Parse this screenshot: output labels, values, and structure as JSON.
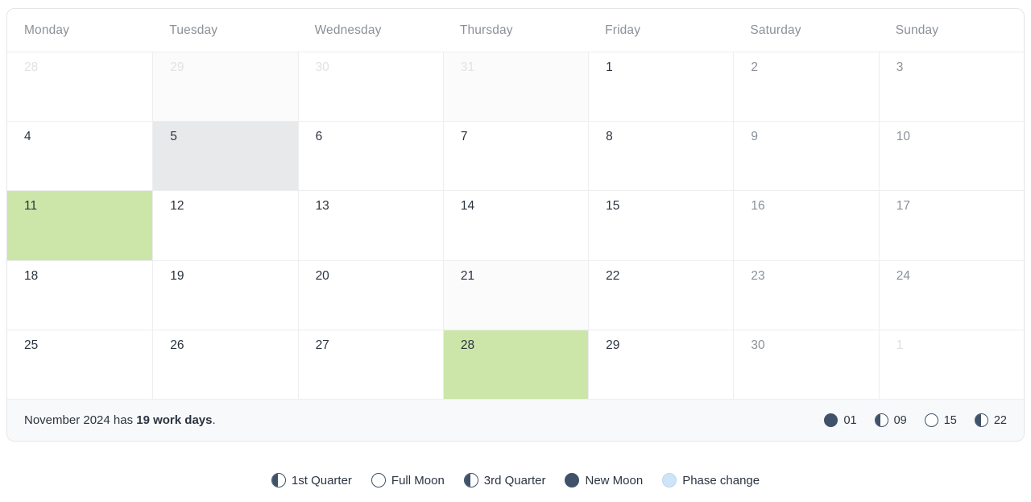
{
  "calendar": {
    "month_label": "November 2024",
    "weekday_headers": [
      "Monday",
      "Tuesday",
      "Wednesday",
      "Thursday",
      "Friday",
      "Saturday",
      "Sunday"
    ],
    "weeks": [
      [
        {
          "day": "28",
          "in_month": false,
          "weekend": false,
          "state": "none"
        },
        {
          "day": "29",
          "in_month": false,
          "weekend": false,
          "state": "tint"
        },
        {
          "day": "30",
          "in_month": false,
          "weekend": false,
          "state": "none"
        },
        {
          "day": "31",
          "in_month": false,
          "weekend": false,
          "state": "tint"
        },
        {
          "day": "1",
          "in_month": true,
          "weekend": false,
          "state": "none"
        },
        {
          "day": "2",
          "in_month": true,
          "weekend": true,
          "state": "none"
        },
        {
          "day": "3",
          "in_month": true,
          "weekend": true,
          "state": "none"
        }
      ],
      [
        {
          "day": "4",
          "in_month": true,
          "weekend": false,
          "state": "none"
        },
        {
          "day": "5",
          "in_month": true,
          "weekend": false,
          "state": "selected"
        },
        {
          "day": "6",
          "in_month": true,
          "weekend": false,
          "state": "none"
        },
        {
          "day": "7",
          "in_month": true,
          "weekend": false,
          "state": "none"
        },
        {
          "day": "8",
          "in_month": true,
          "weekend": false,
          "state": "none"
        },
        {
          "day": "9",
          "in_month": true,
          "weekend": true,
          "state": "none"
        },
        {
          "day": "10",
          "in_month": true,
          "weekend": true,
          "state": "none"
        }
      ],
      [
        {
          "day": "11",
          "in_month": true,
          "weekend": false,
          "state": "holiday"
        },
        {
          "day": "12",
          "in_month": true,
          "weekend": false,
          "state": "none"
        },
        {
          "day": "13",
          "in_month": true,
          "weekend": false,
          "state": "none"
        },
        {
          "day": "14",
          "in_month": true,
          "weekend": false,
          "state": "none"
        },
        {
          "day": "15",
          "in_month": true,
          "weekend": false,
          "state": "none"
        },
        {
          "day": "16",
          "in_month": true,
          "weekend": true,
          "state": "none"
        },
        {
          "day": "17",
          "in_month": true,
          "weekend": true,
          "state": "none"
        }
      ],
      [
        {
          "day": "18",
          "in_month": true,
          "weekend": false,
          "state": "none"
        },
        {
          "day": "19",
          "in_month": true,
          "weekend": false,
          "state": "none"
        },
        {
          "day": "20",
          "in_month": true,
          "weekend": false,
          "state": "none"
        },
        {
          "day": "21",
          "in_month": true,
          "weekend": false,
          "state": "tint"
        },
        {
          "day": "22",
          "in_month": true,
          "weekend": false,
          "state": "none"
        },
        {
          "day": "23",
          "in_month": true,
          "weekend": true,
          "state": "none"
        },
        {
          "day": "24",
          "in_month": true,
          "weekend": true,
          "state": "none"
        }
      ],
      [
        {
          "day": "25",
          "in_month": true,
          "weekend": false,
          "state": "none"
        },
        {
          "day": "26",
          "in_month": true,
          "weekend": false,
          "state": "none"
        },
        {
          "day": "27",
          "in_month": true,
          "weekend": false,
          "state": "none"
        },
        {
          "day": "28",
          "in_month": true,
          "weekend": false,
          "state": "holiday"
        },
        {
          "day": "29",
          "in_month": true,
          "weekend": false,
          "state": "none"
        },
        {
          "day": "30",
          "in_month": true,
          "weekend": true,
          "state": "none"
        },
        {
          "day": "1",
          "in_month": false,
          "weekend": true,
          "state": "none"
        }
      ]
    ],
    "footer": {
      "note_prefix": "November 2024 has ",
      "note_strong": "19 work days",
      "note_suffix": ".",
      "moon_events": [
        {
          "phase": "new",
          "day": "01"
        },
        {
          "phase": "first",
          "day": "09"
        },
        {
          "phase": "full",
          "day": "15"
        },
        {
          "phase": "third",
          "day": "22"
        }
      ]
    }
  },
  "legend": {
    "items": [
      {
        "phase": "first",
        "label": "1st Quarter"
      },
      {
        "phase": "full",
        "label": "Full Moon"
      },
      {
        "phase": "third",
        "label": "3rd Quarter"
      },
      {
        "phase": "new",
        "label": "New Moon"
      },
      {
        "phase": "change",
        "label": "Phase change"
      }
    ]
  },
  "colors": {
    "holiday_green": "#cbe6a8",
    "selected_gray": "#e8e9eb",
    "moon_dark": "#3f5269",
    "phase_change_blue": "#cfe4f6",
    "text_primary": "#2b3440",
    "text_muted": "#8b9199",
    "border": "#eceef0",
    "footer_bg": "#f8f9fa"
  }
}
